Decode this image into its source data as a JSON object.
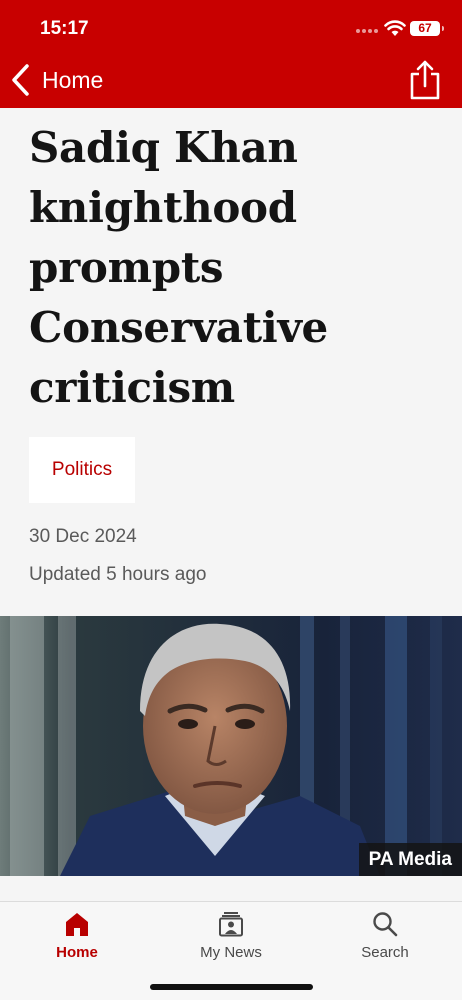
{
  "status_bar": {
    "time": "15:17",
    "battery": "67"
  },
  "nav": {
    "back_label": "Home"
  },
  "article": {
    "headline": "Sadiq Khan knighthood prompts Conservative criticism",
    "topic": "Politics",
    "date": "30 Dec 2024",
    "updated": "Updated 5 hours ago",
    "image_credit": "PA Media"
  },
  "tabs": [
    {
      "label": "Home",
      "icon": "home-icon",
      "active": true
    },
    {
      "label": "My News",
      "icon": "my-news-icon",
      "active": false
    },
    {
      "label": "Search",
      "icon": "search-icon",
      "active": false
    }
  ],
  "colors": {
    "brand_red": "#c80000",
    "accent_red": "#b80000"
  }
}
